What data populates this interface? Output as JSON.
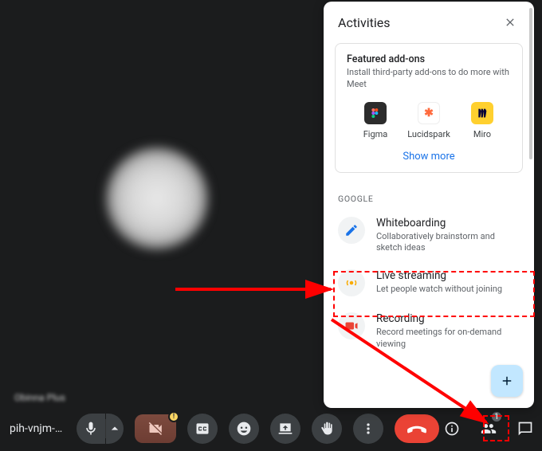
{
  "meeting": {
    "code": "pih-vnjm-…",
    "participant_name": "Obinna Plus",
    "participants_count": "1"
  },
  "activities": {
    "title": "Activities",
    "featured": {
      "title": "Featured add-ons",
      "subtitle": "Install third-party add-ons to do more with Meet",
      "show_more": "Show more",
      "items": [
        {
          "name": "Figma"
        },
        {
          "name": "Lucidspark"
        },
        {
          "name": "Miro"
        }
      ]
    },
    "google_section_label": "GOOGLE",
    "items": [
      {
        "title": "Whiteboarding",
        "subtitle": "Collaboratively brainstorm and sketch ideas"
      },
      {
        "title": "Live streaming",
        "subtitle": "Let people watch without joining"
      },
      {
        "title": "Recording",
        "subtitle": "Record meetings for on-demand viewing"
      }
    ]
  }
}
